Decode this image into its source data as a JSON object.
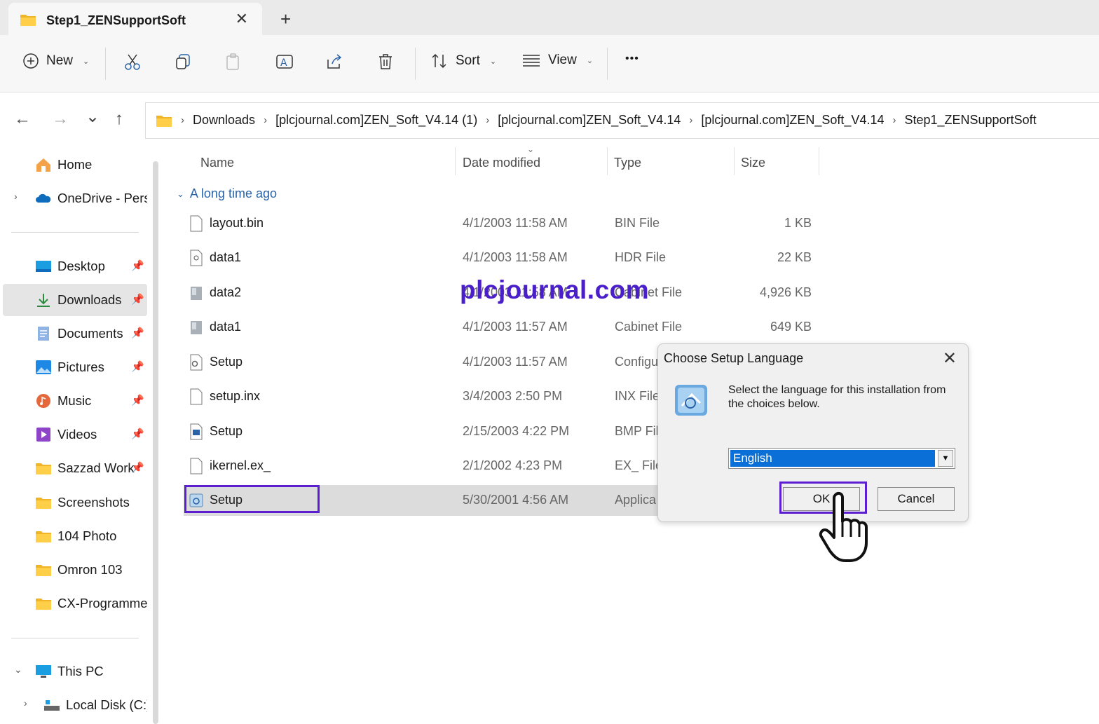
{
  "tab": {
    "title": "Step1_ZENSupportSoft",
    "close": "✕",
    "new_tab": "+"
  },
  "toolbar": {
    "new": "New",
    "sort": "Sort",
    "view": "View",
    "more": "•••"
  },
  "nav": {
    "back": "←",
    "forward": "→",
    "recent": "⌄",
    "up": "↑",
    "breadcrumb": [
      "Downloads",
      "[plcjournal.com]ZEN_Soft_V4.14 (1)",
      "[plcjournal.com]ZEN_Soft_V4.14",
      "[plcjournal.com]ZEN_Soft_V4.14",
      "Step1_ZENSupportSoft"
    ]
  },
  "sidebar": {
    "home": "Home",
    "onedrive": "OneDrive - Perso",
    "pinned": [
      "Desktop",
      "Downloads",
      "Documents",
      "Pictures",
      "Music",
      "Videos",
      "Sazzad Work"
    ],
    "folders": [
      "Screenshots",
      "104 Photo",
      "Omron 103",
      "CX-Programmer"
    ],
    "this_pc": "This PC",
    "local_disk": "Local Disk (C:)"
  },
  "columns": {
    "name": "Name",
    "date": "Date modified",
    "type": "Type",
    "size": "Size"
  },
  "group_label": "A long time ago",
  "files": [
    {
      "name": "layout.bin",
      "date": "4/1/2003 11:58 AM",
      "type": "BIN File",
      "size": "1 KB"
    },
    {
      "name": "data1",
      "date": "4/1/2003 11:58 AM",
      "type": "HDR File",
      "size": "22 KB"
    },
    {
      "name": "data2",
      "date": "4/1/2003 11:58 AM",
      "type": "Cabinet File",
      "size": "4,926 KB"
    },
    {
      "name": "data1",
      "date": "4/1/2003 11:57 AM",
      "type": "Cabinet File",
      "size": "649 KB"
    },
    {
      "name": "Setup",
      "date": "4/1/2003 11:57 AM",
      "type": "Configu",
      "size": ""
    },
    {
      "name": "setup.inx",
      "date": "3/4/2003 2:50 PM",
      "type": "INX File",
      "size": ""
    },
    {
      "name": "Setup",
      "date": "2/15/2003 4:22 PM",
      "type": "BMP File",
      "size": ""
    },
    {
      "name": "ikernel.ex_",
      "date": "2/1/2002 4:23 PM",
      "type": "EX_ File",
      "size": ""
    },
    {
      "name": "Setup",
      "date": "5/30/2001 4:56 AM",
      "type": "Applica",
      "size": ""
    }
  ],
  "watermark": "plcjournal.com",
  "dialog": {
    "title": "Choose Setup Language",
    "close": "✕",
    "message": "Select the language for this installation from the choices below.",
    "language": "English",
    "ok": "OK",
    "cancel": "Cancel"
  },
  "colors": {
    "highlight": "#5b1fd1",
    "selection_blue": "#0a6fd6",
    "watermark": "#4a1ec9",
    "group_blue": "#2a63a8"
  }
}
